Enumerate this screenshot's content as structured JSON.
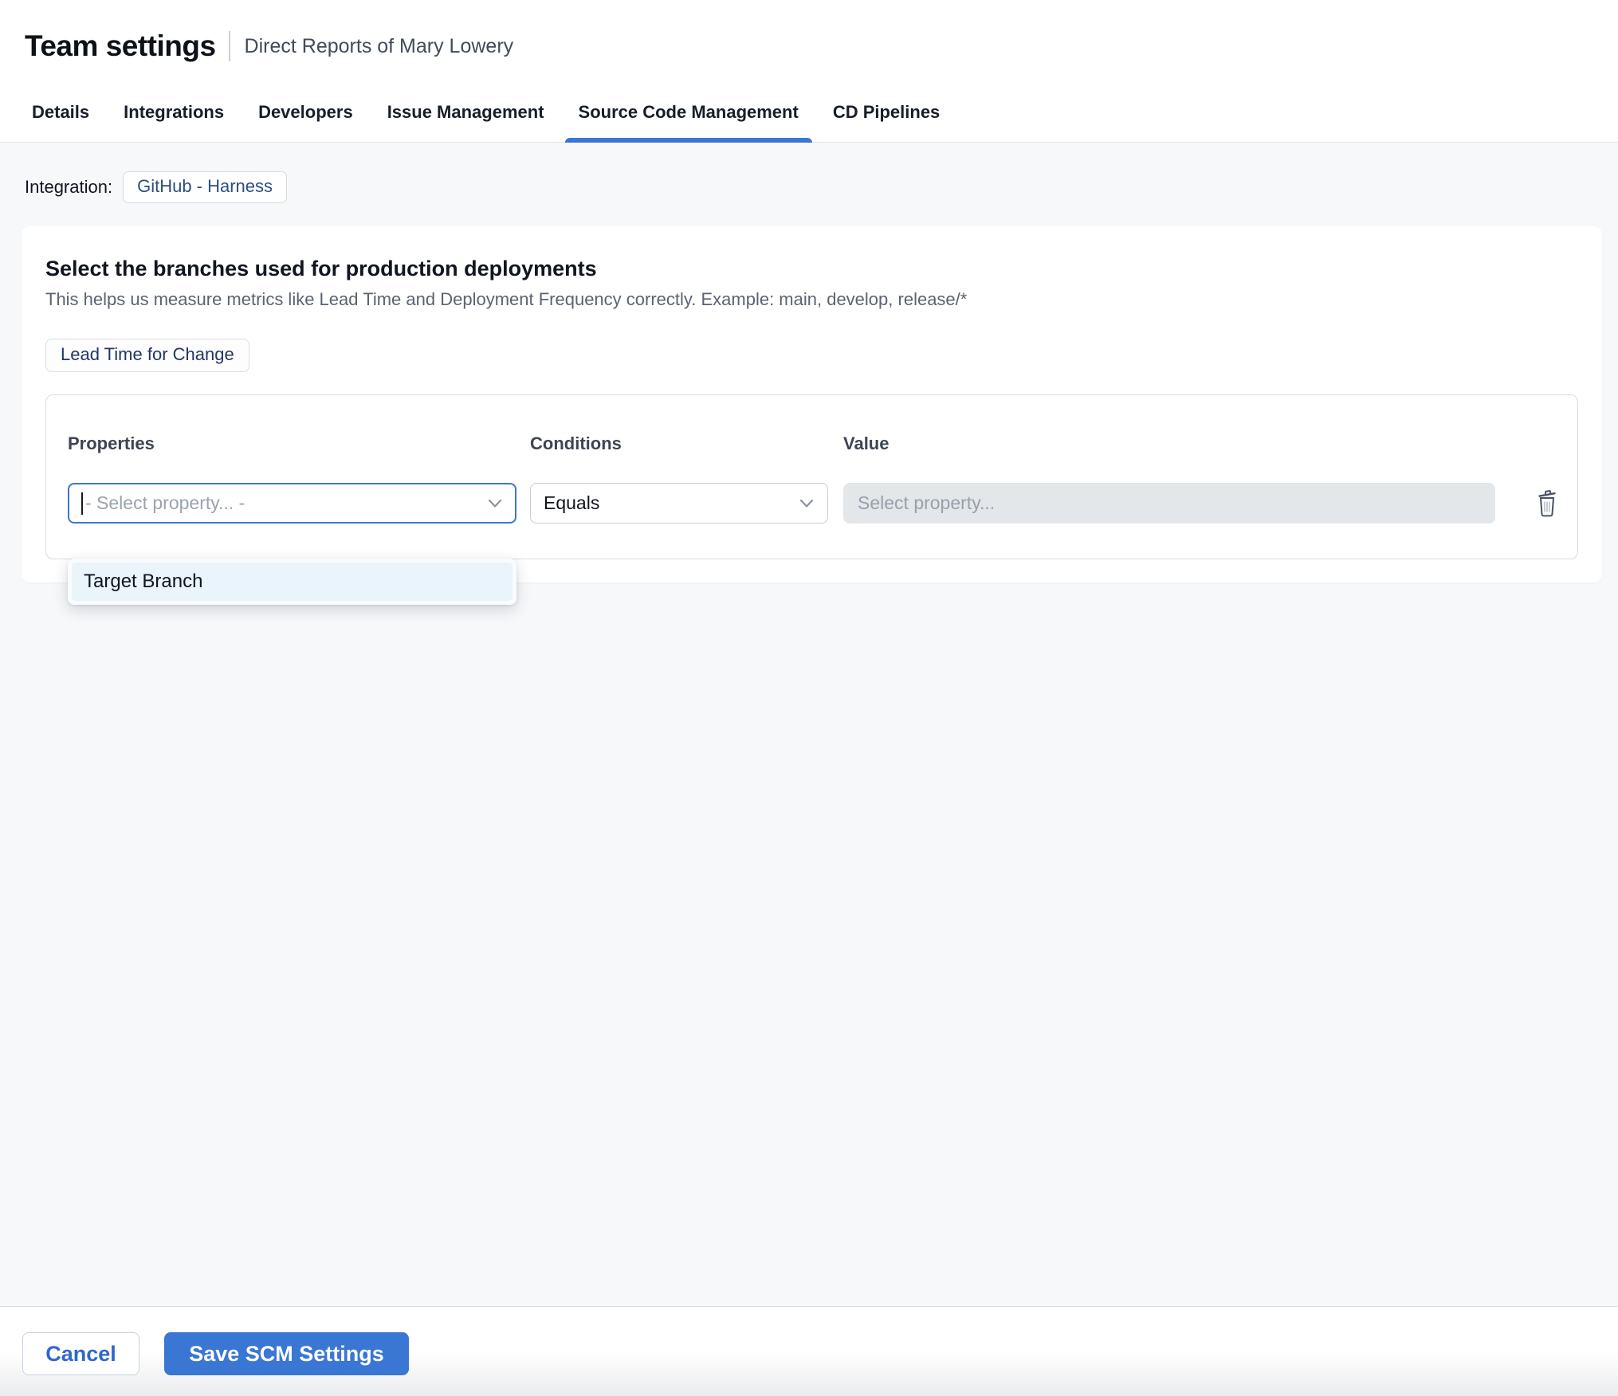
{
  "header": {
    "title": "Team settings",
    "subtitle": "Direct Reports of Mary Lowery"
  },
  "tabs": [
    {
      "label": "Details",
      "active": false
    },
    {
      "label": "Integrations",
      "active": false
    },
    {
      "label": "Developers",
      "active": false
    },
    {
      "label": "Issue Management",
      "active": false
    },
    {
      "label": "Source Code Management",
      "active": true
    },
    {
      "label": "CD Pipelines",
      "active": false
    }
  ],
  "integration": {
    "label": "Integration:",
    "chip": "GitHub - Harness"
  },
  "card": {
    "heading": "Select the branches used for production deployments",
    "description": "This helps us measure metrics like Lead Time and Deployment Frequency correctly. Example: main, develop, release/*",
    "metric_tag": "Lead Time for Change",
    "rule": {
      "properties": {
        "label": "Properties",
        "placeholder": "- Select property... -"
      },
      "conditions": {
        "label": "Conditions",
        "value": "Equals"
      },
      "value": {
        "label": "Value",
        "placeholder": "Select property..."
      },
      "dropdown_options": [
        "Target Branch"
      ]
    }
  },
  "footer": {
    "cancel_label": "Cancel",
    "save_label": "Save SCM Settings"
  },
  "icons": {
    "trash": "trash-icon",
    "chevron": "chevron-down-icon"
  },
  "colors": {
    "accent_blue": "#3a76d3",
    "tab_underline": "#3a76d3",
    "save_button_bg": "#3a76d3",
    "cancel_button_text": "#2f66cb",
    "chip_text": "#2e4d80",
    "tag_text": "#22365f",
    "page_background": "#f7f8fa",
    "disabled_input_bg": "#e3e7ea",
    "dropdown_item_bg": "#e9f4fb",
    "placeholder_text": "#9aa3b0"
  }
}
